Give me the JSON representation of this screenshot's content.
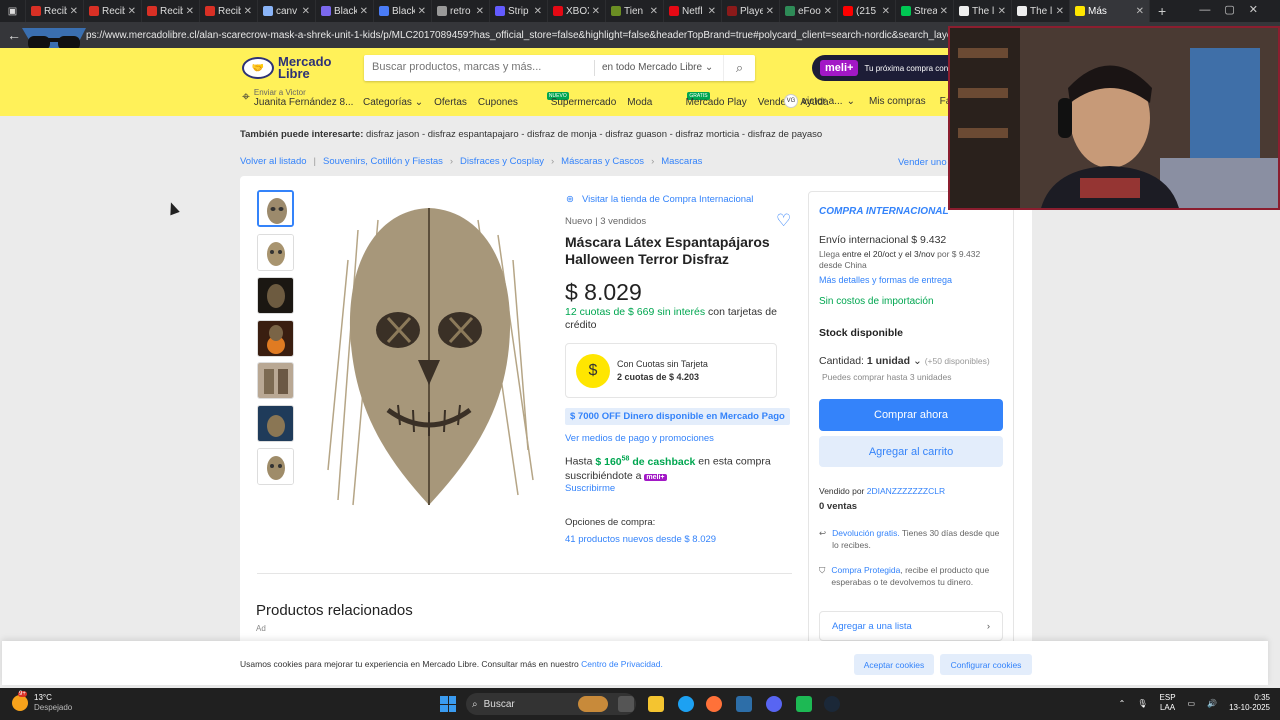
{
  "browser": {
    "tabs": [
      {
        "title": "Recib",
        "color": "#d93025"
      },
      {
        "title": "Recib",
        "color": "#d93025"
      },
      {
        "title": "Recib",
        "color": "#d93025"
      },
      {
        "title": "Recib",
        "color": "#d93025"
      },
      {
        "title": "canv",
        "color": "#8ab4f8"
      },
      {
        "title": "Black",
        "color": "#7b68ee"
      },
      {
        "title": "Black",
        "color": "#4a7cf7"
      },
      {
        "title": "retro",
        "color": "#999999"
      },
      {
        "title": "Strip",
        "color": "#635bff"
      },
      {
        "title": "XBOX",
        "color": "#e50914"
      },
      {
        "title": "Tien",
        "color": "#6b8e23"
      },
      {
        "title": "Netfl",
        "color": "#e50914"
      },
      {
        "title": "Playe",
        "color": "#8b1a1a"
      },
      {
        "title": "eFoo",
        "color": "#2e8b57"
      },
      {
        "title": "(215",
        "color": "#ff0000"
      },
      {
        "title": "Strea",
        "color": "#00c853"
      },
      {
        "title": "The l",
        "color": "#eeeeee"
      },
      {
        "title": "The l",
        "color": "#eeeeee"
      },
      {
        "title": "Más",
        "color": "#ffe600"
      }
    ],
    "new_tab": "+",
    "url": "ps://www.mercadolibre.cl/alan-scarecrow-mask-a-shrek-unit-1-kids/p/MLC2017089459?has_official_store=false&highlight=false&headerTopBrand=true#polycard_client=search-nordic&search_layout=grid&po"
  },
  "header": {
    "logo_line1": "Mercado",
    "logo_line2": "Libre",
    "search_placeholder": "Buscar productos, marcas y más...",
    "search_scope": "en todo Mercado Libre",
    "meli_pill": "meli+",
    "meli_sub": "Tu próxima compra con",
    "location_label": "Enviar a Victor",
    "location_value": "Juanita Fernández 8...",
    "nav": [
      "Categorías",
      "Ofertas",
      "Cupones",
      "Supermercado",
      "Moda",
      "Mercado Play",
      "Vender",
      "Ayuda"
    ],
    "nuevo_badge": "NUEVO",
    "gratis_badge": "GRATIS",
    "user_initials": "VG",
    "user_name": "victor a...",
    "mis_compras": "Mis compras",
    "favoritos": "Favori"
  },
  "related": {
    "label": "También puede interesarte:",
    "items": "disfraz jason - disfraz espantapajaro - disfraz de monja - disfraz guason - disfraz morticia - disfraz de payaso"
  },
  "breadcrumbs": [
    "Volver al listado",
    "Souvenirs, Cotillón y Fiestas",
    "Disfraces y Cosplay",
    "Máscaras y Cascos",
    "Mascaras"
  ],
  "sell_link": "Vender uno",
  "product": {
    "store_link": "Visitar la tienda de Compra Internacional",
    "condition": "Nuevo  |  3 vendidos",
    "title": "Máscara Látex Espantapájaros Halloween Terror Disfraz",
    "price": "$ 8.029",
    "cuotas_green": "12 cuotas de $ 669 sin interés",
    "cuotas_rest": " con tarjetas de crédito",
    "cuota_box_t1": "Con Cuotas sin Tarjeta",
    "cuota_box_t2": "2 cuotas de $ 4.203",
    "off_tag": "$ 7000 OFF Dinero disponible en Mercado Pago",
    "medios": "Ver medios de pago y promociones",
    "cashback_pre": "Hasta ",
    "cashback_amt": "$ 160",
    "cashback_sup": "58",
    "cashback_green": " de cashback",
    "cashback_post": " en esta compra suscribiéndote a ",
    "cashback_badge": "meli+",
    "suscribirme": "Suscribirme",
    "opciones": "Opciones de compra:",
    "nuevos": "41 productos nuevos desde $ 8.029",
    "related_title": "Productos relacionados",
    "ad": "Ad"
  },
  "buybox": {
    "intl": "COMPRA INTERNACIONAL",
    "envio": "Envío internacional $ 9.432",
    "llega_pre": "Llega ",
    "llega_dates": "entre el 20/oct y el 3/nov",
    "llega_post": " por $ 9.432 desde China",
    "detalles": "Más detalles y formas de entrega",
    "sin_costos": "Sin costos de importación",
    "stock": "Stock disponible",
    "cantidad_label": "Cantidad: ",
    "cantidad_value": "1 unidad",
    "disponibles": "(+50 disponibles)",
    "hasta": "Puedes comprar hasta 3 unidades",
    "buy": "Comprar ahora",
    "cart": "Agregar al carrito",
    "vendido_pre": "Vendido por ",
    "vendedor": "2DIANZZZZZZZCLR",
    "ventas": "0 ventas",
    "devol_link": "Devolución gratis.",
    "devol_text": " Tienes 30 días desde que lo recibes.",
    "protect_link": "Compra Protegida",
    "protect_text": ", recibe el producto que esperabas o te devolvemos tu dinero.",
    "agregar_lista": "Agregar a una lista"
  },
  "cookie": {
    "text": "Usamos cookies para mejorar tu experiencia en Mercado Libre. Consultar más en nuestro ",
    "link": "Centro de Privacidad.",
    "accept": "Aceptar cookies",
    "configure": "Configurar cookies"
  },
  "taskbar": {
    "temp": "13°C",
    "weather": "Despejado",
    "weather_badge": "9+",
    "search": "Buscar",
    "lang1": "ESP",
    "lang2": "LAA",
    "time": "0:35",
    "date": "13-10-2025"
  },
  "colors": {
    "ml_yellow": "#fff159",
    "ml_blue": "#3483fa",
    "green": "#00a650",
    "meli_purple": "#a218c6"
  }
}
